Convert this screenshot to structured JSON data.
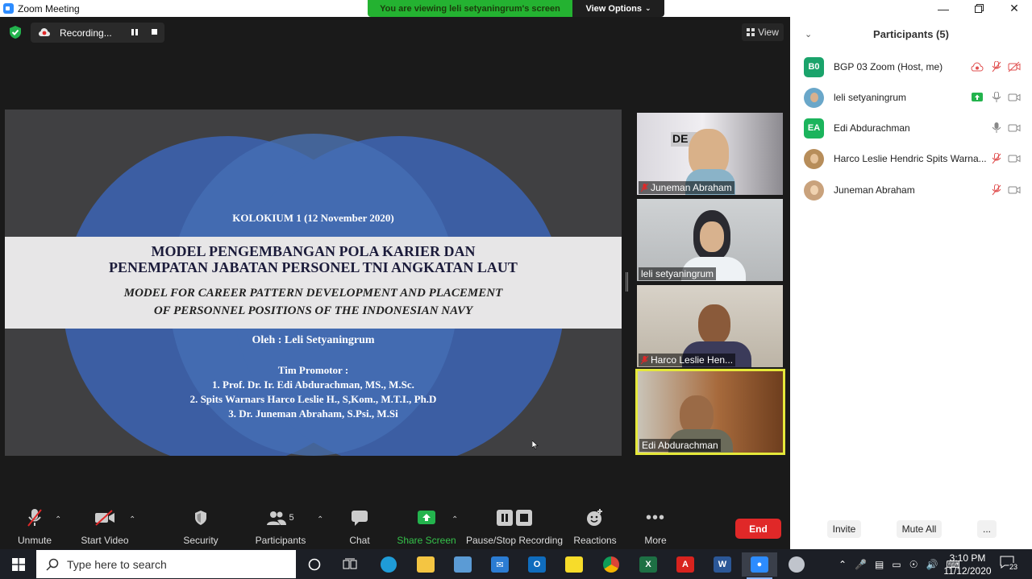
{
  "window": {
    "title": "Zoom Meeting"
  },
  "banner": {
    "viewing_text": "You are viewing leli setyaningrum's screen",
    "view_options": "View Options"
  },
  "recording": {
    "label": "Recording..."
  },
  "view_button": {
    "label": "View"
  },
  "slide": {
    "header": "KOLOKIUM 1  (12 November 2020)",
    "title_line1": "MODEL PENGEMBANGAN POLA KARIER DAN",
    "title_line2": "PENEMPATAN JABATAN PERSONEL TNI ANGKATAN LAUT",
    "subtitle_line1": "MODEL FOR CAREER PATTERN DEVELOPMENT AND PLACEMENT",
    "subtitle_line2": "OF PERSONNEL POSITIONS OF THE INDONESIAN NAVY",
    "author": "Oleh : Leli Setyaningrum",
    "promotor_heading": "Tim Promotor :",
    "promotor_1": "1. Prof. Dr. Ir. Edi Abdurachman, MS., M.Sc.",
    "promotor_2": "2. Spits Warnars Harco Leslie H., S,Kom., M.T.I., Ph.D",
    "promotor_3": "3. Dr. Juneman Abraham, S.Psi., M.Si"
  },
  "tiles": [
    {
      "name": "Juneman Abraham",
      "muted": true
    },
    {
      "name": "leli setyaningrum",
      "muted": false
    },
    {
      "name": "Harco Leslie Hen...",
      "muted": true
    },
    {
      "name": "Edi Abdurachman",
      "muted": false,
      "speaking": true
    }
  ],
  "participants": {
    "header": "Participants (5)",
    "list": [
      {
        "initials": "B0",
        "name": "BGP 03 Zoom (Host, me)",
        "avatar_color": "#1aa36b"
      },
      {
        "initials": "",
        "name": "leli setyaningrum",
        "avatar_color": "#6aa7c9"
      },
      {
        "initials": "EA",
        "name": "Edi Abdurachman",
        "avatar_color": "#1bb45c"
      },
      {
        "initials": "",
        "name": "Harco Leslie Hendric Spits Warna...",
        "avatar_color": "#b78d5a"
      },
      {
        "initials": "",
        "name": "Juneman Abraham",
        "avatar_color": "#c9a27c"
      }
    ],
    "invite": "Invite",
    "mute_all": "Mute All",
    "more": "..."
  },
  "toolbar": {
    "unmute": "Unmute",
    "start_video": "Start Video",
    "security": "Security",
    "participants": "Participants",
    "participants_count": "5",
    "chat": "Chat",
    "share_screen": "Share Screen",
    "pause_stop_recording": "Pause/Stop Recording",
    "reactions": "Reactions",
    "more": "More",
    "end": "End"
  },
  "taskbar": {
    "search_placeholder": "Type here to search",
    "time": "3:10 PM",
    "date": "11/12/2020",
    "notification_count": "23"
  },
  "colors": {
    "accent_green": "#24b231",
    "end_red": "#e02828",
    "speaker_highlight": "#e5e83a",
    "slide_circle": "#3f62a8"
  }
}
